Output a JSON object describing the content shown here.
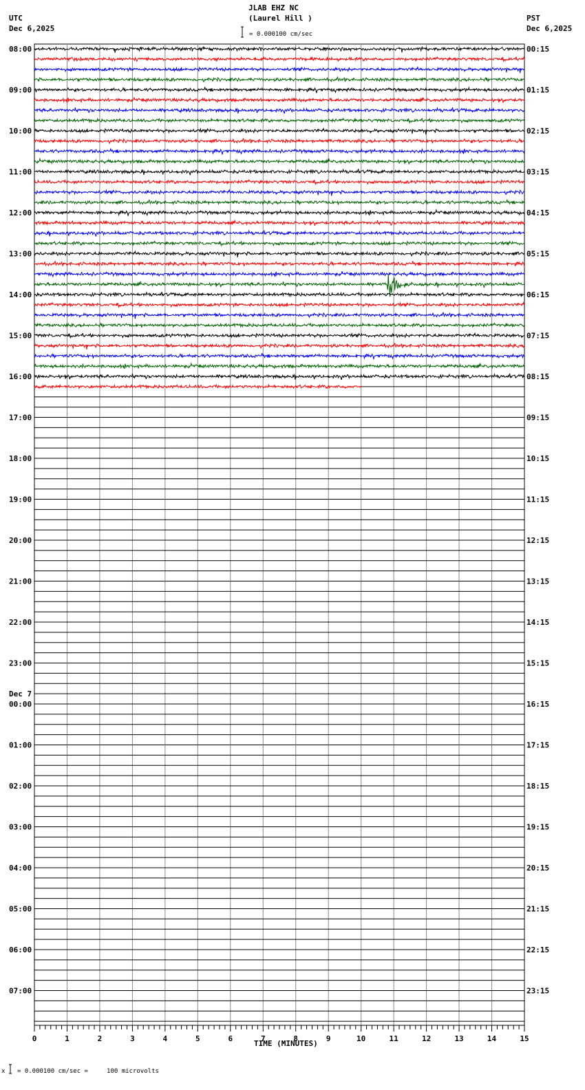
{
  "header": {
    "station": "JLAB EHZ NC",
    "location": "(Laurel Hill )",
    "scale": "= 0.000100 cm/sec",
    "left_tz": "UTC",
    "left_date": "Dec 6,2025",
    "right_tz": "PST",
    "right_date": "Dec 6,2025"
  },
  "footer": {
    "scale_text": "= 0.000100 cm/sec =     100 microvolts",
    "marker": "x"
  },
  "chart_data": {
    "type": "line",
    "title": "JLAB EHZ NC (Laurel Hill )",
    "xlabel": "TIME (MINUTES)",
    "xlim": [
      0,
      15
    ],
    "x_ticks": [
      "0",
      "1",
      "2",
      "3",
      "4",
      "5",
      "6",
      "7",
      "8",
      "9",
      "10",
      "11",
      "12",
      "13",
      "14",
      "15"
    ],
    "rows_per_hour": 4,
    "total_rows": 96,
    "trace_colors": [
      "#000000",
      "#ff0000",
      "#0000ff",
      "#006400"
    ],
    "filled_rows": 33,
    "last_row_end_minute": 10,
    "left_labels": [
      "08:00",
      "09:00",
      "10:00",
      "11:00",
      "12:00",
      "13:00",
      "14:00",
      "15:00",
      "16:00",
      "17:00",
      "18:00",
      "19:00",
      "20:00",
      "21:00",
      "22:00",
      "23:00",
      "00:00",
      "01:00",
      "02:00",
      "03:00",
      "04:00",
      "05:00",
      "06:00",
      "07:00"
    ],
    "date_change_label": "Dec 7",
    "date_change_index": 16,
    "right_labels": [
      "00:15",
      "01:15",
      "02:15",
      "03:15",
      "04:15",
      "05:15",
      "06:15",
      "07:15",
      "08:15",
      "09:15",
      "10:15",
      "11:15",
      "12:15",
      "13:15",
      "14:15",
      "15:15",
      "16:15",
      "17:15",
      "18:15",
      "19:15",
      "20:15",
      "21:15",
      "22:15",
      "23:15"
    ],
    "events": [
      {
        "row": 23,
        "minute": 10.8,
        "amplitude": 4.5,
        "duration_min": 1.0
      },
      {
        "row": 27,
        "minute": 3.95,
        "amplitude": 1.2,
        "duration_min": 0.15
      }
    ]
  }
}
